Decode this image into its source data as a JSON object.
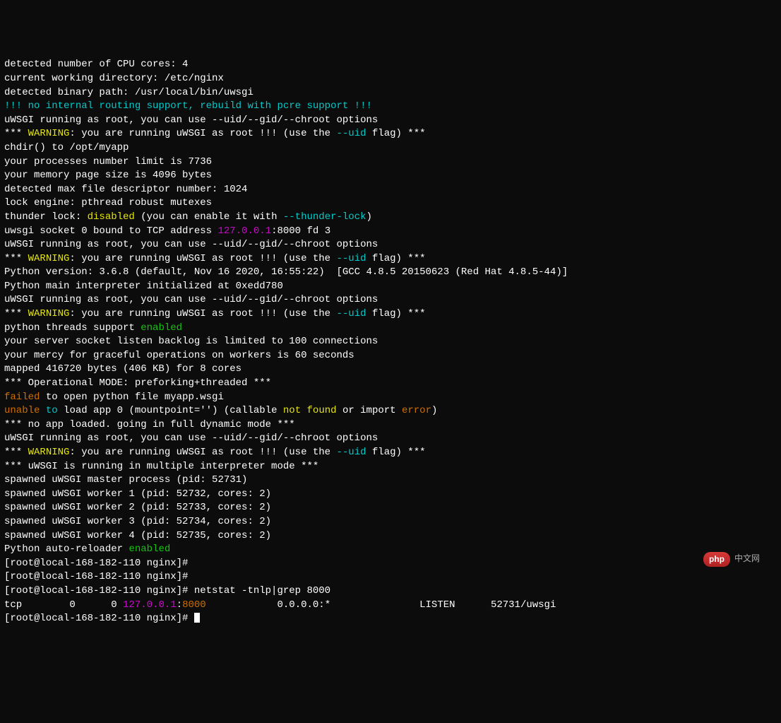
{
  "l1": "detected number of CPU cores: 4",
  "l2": "current working directory: /etc/nginx",
  "l3": "detected binary path: /usr/local/bin/uwsgi",
  "l4": "!!! no internal routing support, rebuild with pcre support !!!",
  "l5": "uWSGI running as root, you can use --uid/--gid/--chroot options",
  "warn_prefix": "*** ",
  "warn_word": "WARNING",
  "warn_mid": ": you are running uWSGI as root !!! (use the ",
  "warn_flag": "--uid",
  "warn_suffix": " flag) ***",
  "l7": "chdir() to /opt/myapp",
  "l8": "your processes number limit is 7736",
  "l9": "your memory page size is 4096 bytes",
  "l10": "detected max file descriptor number: 1024",
  "l11": "lock engine: pthread robust mutexes",
  "l12a": "thunder lock: ",
  "l12b": "disabled",
  "l12c": " (you can enable it with ",
  "l12d": "--thunder-lock",
  "l12e": ")",
  "l13a": "uwsgi socket 0 bound to TCP address ",
  "l13b": "127.0.0.1",
  "l13c": ":8000 fd 3",
  "l14": "uWSGI running as root, you can use --uid/--gid/--chroot options",
  "l16": "Python version: 3.6.8 (default, Nov 16 2020, 16:55:22)  [GCC 4.8.5 20150623 (Red Hat 4.8.5-44)]",
  "l17": "Python main interpreter initialized at 0xedd780",
  "l18": "uWSGI running as root, you can use --uid/--gid/--chroot options",
  "l20a": "python threads support ",
  "l20b": "enabled",
  "l21": "your server socket listen backlog is limited to 100 connections",
  "l22": "your mercy for graceful operations on workers is 60 seconds",
  "l23": "mapped 416720 bytes (406 KB) for 8 cores",
  "l24": "*** Operational MODE: preforking+threaded ***",
  "l25a": "failed",
  "l25b": " to open python file myapp.wsgi",
  "l26a": "unable",
  "l26b": " ",
  "l26c": "to",
  "l26d": " load app 0 (mountpoint='') (callable ",
  "l26e": "not",
  "l26f": " ",
  "l26g": "found",
  "l26h": " or import ",
  "l26i": "error",
  "l26j": ")",
  "l27": "*** no app loaded. going in full dynamic mode ***",
  "l28": "uWSGI running as root, you can use --uid/--gid/--chroot options",
  "l30": "*** uWSGI is running in multiple interpreter mode ***",
  "l31": "spawned uWSGI master process (pid: 52731)",
  "l32": "spawned uWSGI worker 1 (pid: 52732, cores: 2)",
  "l33": "spawned uWSGI worker 2 (pid: 52733, cores: 2)",
  "l34": "spawned uWSGI worker 3 (pid: 52734, cores: 2)",
  "l35": "spawned uWSGI worker 4 (pid: 52735, cores: 2)",
  "l36a": "Python auto-reloader ",
  "l36b": "enabled",
  "prompt": "[root@local-168-182-110 nginx]# ",
  "cmd": "netstat -tnlp|grep 8000",
  "net_a": "tcp        0      0 ",
  "net_b": "127.0.0.1",
  "net_c": ":",
  "net_d": "8000",
  "net_e": "            0.0.0.0:*               LISTEN      52731/uwsgi         ",
  "logo_text": "php",
  "logo_cn": "中文网"
}
